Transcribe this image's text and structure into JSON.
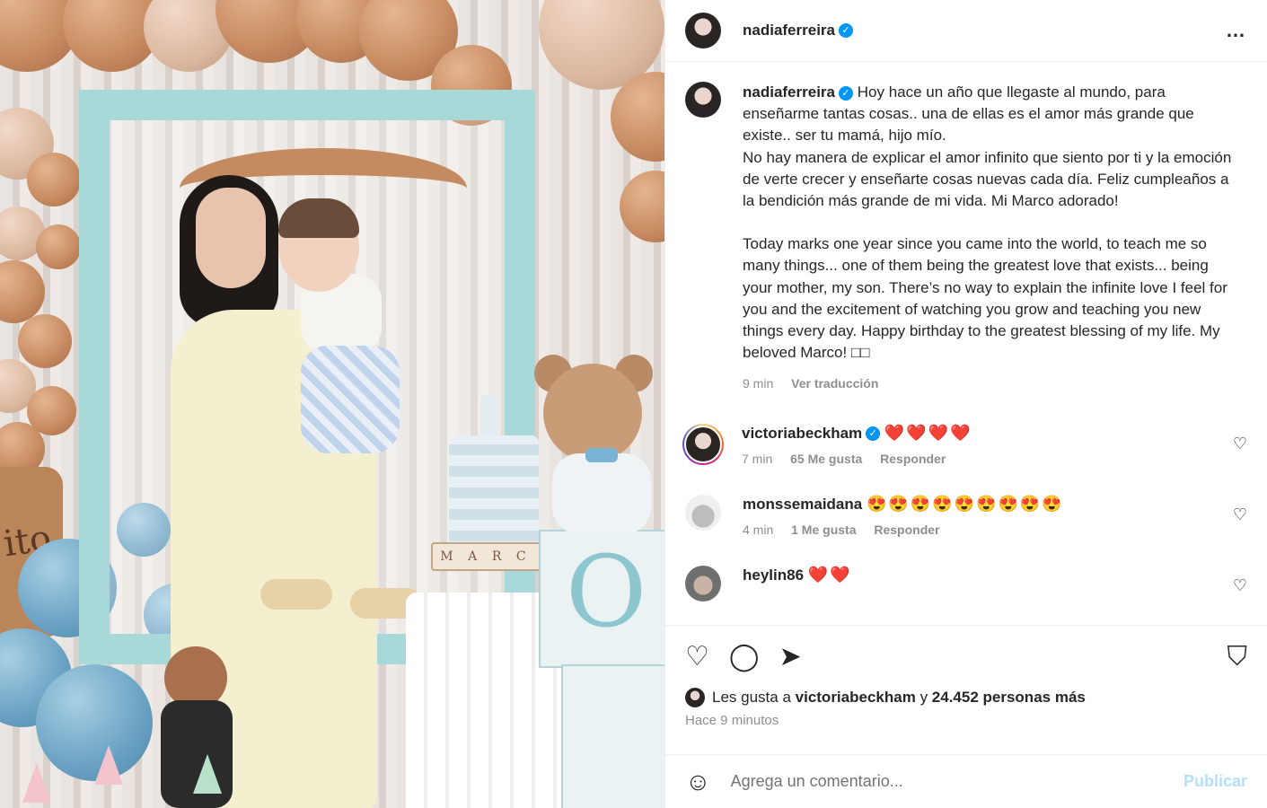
{
  "post": {
    "username": "nadiaferreira",
    "verified_mark": "✓"
  },
  "photo": {
    "cake_tag_letters": [
      "M",
      "A",
      "R",
      "C",
      "O"
    ],
    "block_letter": "O",
    "sign_text": "ito"
  },
  "caption": {
    "username": "nadiaferreira",
    "text_es": "Hoy hace un año que llegaste al mundo, para enseñarme tantas cosas.. una de ellas es el amor más grande que existe.. ser tu mamá, hijo mío.\nNo hay manera de explicar el amor infinito que siento por ti y la emoción de verte crecer y enseñarte cosas nuevas cada día. Feliz cumpleaños a la bendición más grande de mi vida. Mi Marco adorado!",
    "text_en": "Today marks one year since you came into the world, to teach me so many things... one of them being the greatest love that exists... being your mother, my son. There’s no way to explain the infinite love I feel for you and the excitement of watching you grow and teaching you new things every day. Happy birthday to the greatest blessing of my life. My beloved Marco! ",
    "end_glyphs": "□□",
    "time": "9 min",
    "translate": "Ver traducción"
  },
  "comments": [
    {
      "username": "victoriabeckham",
      "verified": true,
      "text": "❤️❤️❤️❤️",
      "time": "7 min",
      "likes": "65 Me gusta",
      "reply": "Responder"
    },
    {
      "username": "monssemaidana",
      "verified": false,
      "text": "😍😍😍😍😍😍😍😍😍",
      "time": "4 min",
      "likes": "1 Me gusta",
      "reply": "Responder"
    },
    {
      "username": "heylin86",
      "verified": false,
      "text": "❤️❤️",
      "time": "",
      "likes": "",
      "reply": ""
    }
  ],
  "icons": {
    "more": "…",
    "like": "♡",
    "comment": "◯",
    "share": "➤",
    "save": "⛉",
    "emoji": "☺"
  },
  "likes": {
    "prefix": "Les gusta a",
    "user": "victoriabeckham",
    "joiner": "y",
    "others": "24.452 personas más"
  },
  "timestamp": "Hace 9 minutos",
  "composer": {
    "placeholder": "Agrega un comentario...",
    "publish": "Publicar"
  },
  "colors": {
    "accent": "#0095f6",
    "publish_disabled": "#b2dffc",
    "heart_red": "#e8223a"
  }
}
